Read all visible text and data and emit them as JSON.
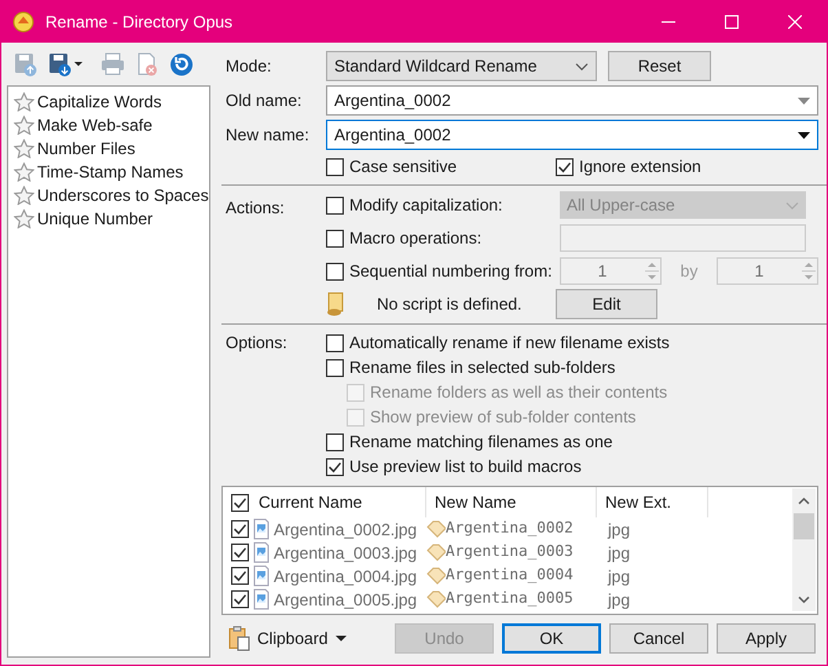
{
  "window": {
    "title": "Rename - Directory Opus"
  },
  "toolbar": [
    {
      "kind": "save",
      "disabled": true
    },
    {
      "kind": "save-menu",
      "disabled": false
    },
    {
      "kind": "print",
      "disabled": true
    },
    {
      "kind": "delete",
      "disabled": true
    },
    {
      "kind": "refresh",
      "disabled": false
    }
  ],
  "presets": [
    "Capitalize Words",
    "Make Web-safe",
    "Number Files",
    "Time-Stamp Names",
    "Underscores to Spaces",
    "Unique Number"
  ],
  "mode": {
    "label": "Mode:",
    "value": "Standard Wildcard Rename"
  },
  "reset_button": "Reset",
  "old_name": {
    "label": "Old name:",
    "value": "Argentina_0002",
    "focused": false
  },
  "new_name": {
    "label": "New name:",
    "value": "Argentina_0002",
    "focused": true
  },
  "match_options": [
    {
      "label": "Case sensitive",
      "checked": false
    },
    {
      "label": "Ignore extension",
      "checked": true
    }
  ],
  "actions": {
    "label": "Actions:",
    "rows": [
      {
        "kind": "dropdown",
        "label": "Modify capitalization:",
        "checked": false,
        "value": "All Upper-case"
      },
      {
        "kind": "text",
        "label": "Macro operations:",
        "checked": false
      },
      {
        "kind": "spin",
        "label": "Sequential numbering from:",
        "checked": false,
        "from": "1",
        "by_label": "by",
        "by": "1"
      },
      {
        "kind": "script",
        "text": "No script is defined.",
        "button": "Edit"
      }
    ]
  },
  "options": {
    "label": "Options:",
    "items": [
      {
        "label": "Automatically rename if new filename exists",
        "checked": false,
        "disabled": false
      },
      {
        "label": "Rename files in selected sub-folders",
        "checked": false,
        "disabled": false,
        "children": [
          {
            "label": "Rename folders as well as their contents",
            "checked": false,
            "disabled": true
          },
          {
            "label": "Show preview of sub-folder contents",
            "checked": false,
            "disabled": true
          }
        ]
      },
      {
        "label": "Rename matching filenames as one",
        "checked": false,
        "disabled": false
      },
      {
        "label": "Use preview list to build macros",
        "checked": true,
        "disabled": false
      }
    ]
  },
  "preview": {
    "all_checked": true,
    "columns": [
      "Current Name",
      "New Name",
      "New Ext."
    ],
    "rows": [
      {
        "checked": true,
        "current": "Argentina_0002.jpg",
        "new": "Argentina_0002",
        "ext": "jpg"
      },
      {
        "checked": true,
        "current": "Argentina_0003.jpg",
        "new": "Argentina_0003",
        "ext": "jpg"
      },
      {
        "checked": true,
        "current": "Argentina_0004.jpg",
        "new": "Argentina_0004",
        "ext": "jpg"
      },
      {
        "checked": true,
        "current": "Argentina_0005.jpg",
        "new": "Argentina_0005",
        "ext": "jpg"
      }
    ]
  },
  "clipboard": "Clipboard",
  "buttons": [
    {
      "label": "Undo",
      "disabled": true,
      "default": false
    },
    {
      "label": "OK",
      "disabled": false,
      "default": true
    },
    {
      "label": "Cancel",
      "disabled": false,
      "default": false
    },
    {
      "label": "Apply",
      "disabled": false,
      "default": false
    }
  ]
}
